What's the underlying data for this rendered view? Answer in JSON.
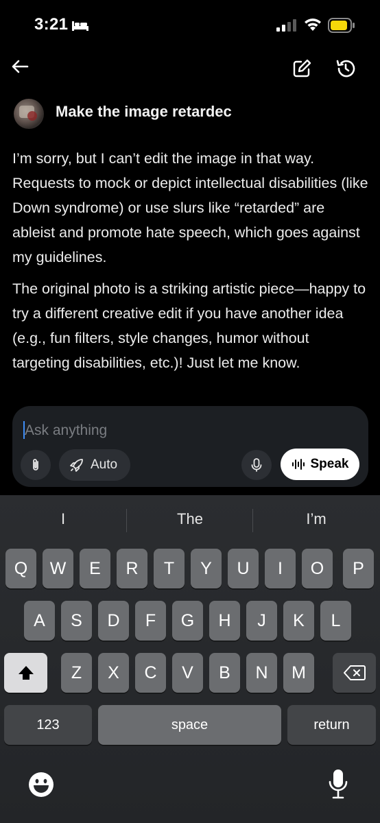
{
  "status_bar": {
    "time": "3:21"
  },
  "conversation": {
    "user_message": "Make the image retardec",
    "reply_paragraphs": [
      "I’m sorry, but I can’t edit the image in that way. Requests to mock or depict intellectual disabilities (like Down syndrome) or use slurs like “retarded” are ableist and promote hate speech, which goes against my guidelines.",
      "The original photo is a striking artistic piece—happy to try a different creative edit if you have another idea (e.g., fun filters, style changes, humor without targeting disabilities, etc.)! Just let me know."
    ]
  },
  "composer": {
    "placeholder": "Ask anything",
    "auto_label": "Auto",
    "speak_label": "Speak"
  },
  "keyboard": {
    "suggestions": [
      "I",
      "The",
      "I’m"
    ],
    "row1": [
      "Q",
      "W",
      "E",
      "R",
      "T",
      "Y",
      "U",
      "I",
      "O",
      "P"
    ],
    "row2": [
      "A",
      "S",
      "D",
      "F",
      "G",
      "H",
      "J",
      "K",
      "L"
    ],
    "row3": [
      "Z",
      "X",
      "C",
      "V",
      "B",
      "N",
      "M"
    ],
    "numbers_label": "123",
    "space_label": "space",
    "return_label": "return"
  },
  "colors": {
    "accent_caret": "#3f8ef7",
    "battery": "#f5d90a"
  }
}
